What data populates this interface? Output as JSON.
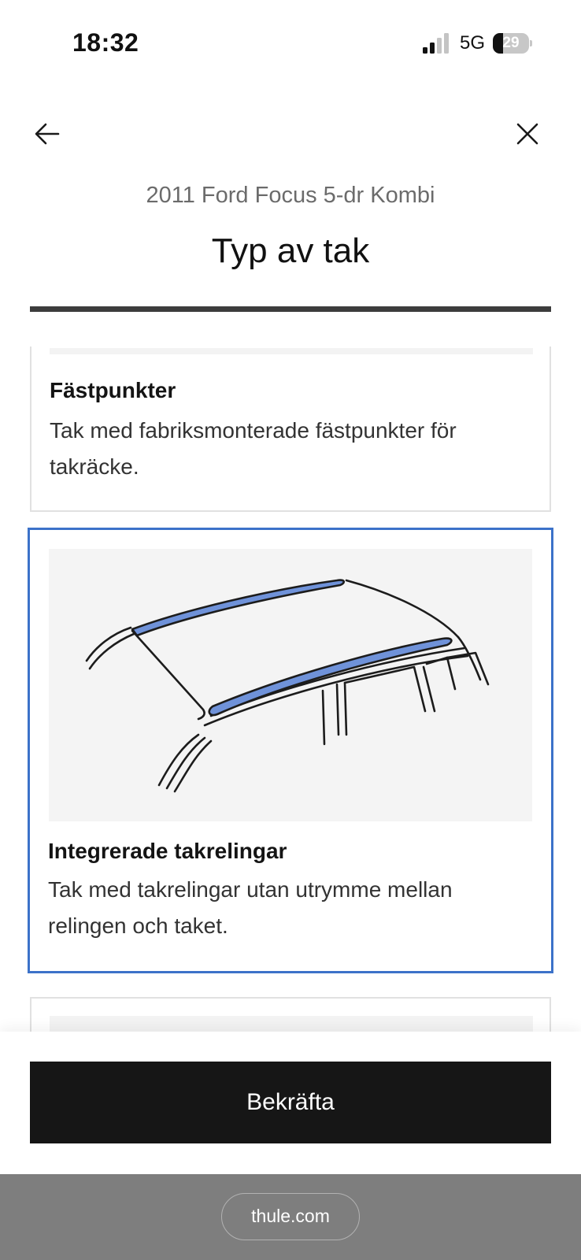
{
  "status_bar": {
    "time": "18:32",
    "network": "5G",
    "battery": "29",
    "battery_level": 0.29,
    "signal_bars_active": 2,
    "signal_bars_total": 4,
    "icons": [
      "signal-icon",
      "battery-icon"
    ]
  },
  "header": {
    "back_icon": "arrow-left-icon",
    "close_icon": "close-icon",
    "vehicle": "2011 Ford Focus 5-dr Kombi",
    "title": "Typ av tak",
    "progress": 1.0
  },
  "options": [
    {
      "title": "Fästpunkter",
      "description": "Tak med fabriksmonterade fästpunkter för takräcke.",
      "selected": false
    },
    {
      "title": "Integrerade takrelingar",
      "description": "Tak med takrelingar utan utrymme mellan relingen och taket.",
      "selected": true
    }
  ],
  "colors": {
    "selected_border": "#3c72c9",
    "rail_fill": "#6f92d9",
    "button_bg": "#161616",
    "progress_fill": "#3c3c3c"
  },
  "footer": {
    "confirm_label": "Bekräfta"
  },
  "browser": {
    "url": "thule.com"
  }
}
